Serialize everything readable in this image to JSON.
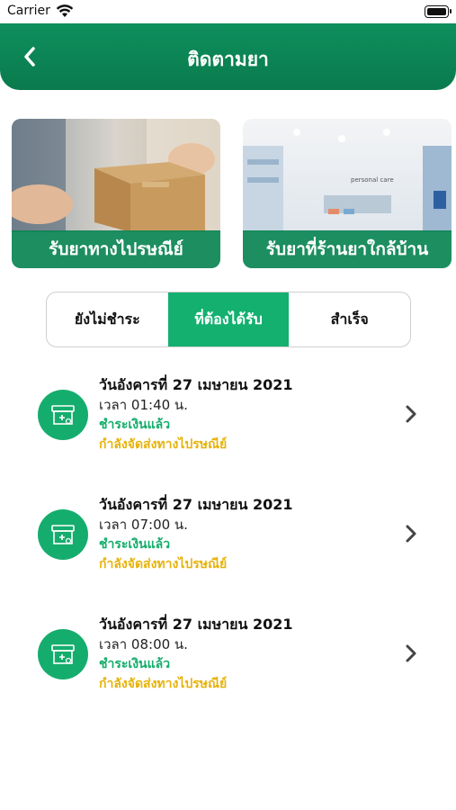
{
  "status_bar": {
    "carrier": "Carrier",
    "wifi_icon": "wifi-icon",
    "battery_icon": "battery-icon"
  },
  "header": {
    "title": "ติดตามยา",
    "back_icon": "chevron-left-icon",
    "color": "#0c8755"
  },
  "cards": [
    {
      "label": "รับยาทางไปรษณีย์",
      "image": "delivery-box-photo"
    },
    {
      "label": "รับยาที่ร้านยาใกล้บ้าน",
      "image": "pharmacy-store-photo"
    }
  ],
  "tabs": [
    {
      "label": "ยังไม่ชำระ",
      "active": false
    },
    {
      "label": "ที่ต้องได้รับ",
      "active": true
    },
    {
      "label": "สำเร็จ",
      "active": false
    }
  ],
  "accent_color": "#13b06f",
  "orders": [
    {
      "date": "วันอังคารที่ 27 เมษายน 2021",
      "time": "เวลา 01:40 น.",
      "payment": "ชำระเงินแล้ว",
      "shipping": "กำลังจัดส่งทางไปรษณีย์",
      "icon": "medicine-box-icon"
    },
    {
      "date": "วันอังคารที่ 27 เมษายน 2021",
      "time": "เวลา 07:00 น.",
      "payment": "ชำระเงินแล้ว",
      "shipping": "กำลังจัดส่งทางไปรษณีย์",
      "icon": "medicine-box-icon"
    },
    {
      "date": "วันอังคารที่ 27 เมษายน 2021",
      "time": "เวลา 08:00 น.",
      "payment": "ชำระเงินแล้ว",
      "shipping": "กำลังจัดส่งทางไปรษณีย์",
      "icon": "medicine-box-icon"
    }
  ]
}
